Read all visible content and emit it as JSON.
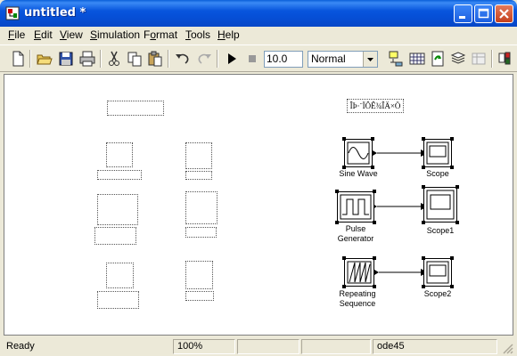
{
  "window": {
    "title": "untitled *"
  },
  "menu": [
    {
      "label": "File",
      "key": "F"
    },
    {
      "label": "Edit",
      "key": "E"
    },
    {
      "label": "View",
      "key": "V"
    },
    {
      "label": "Simulation",
      "key": "S"
    },
    {
      "label": "Format",
      "key": "o"
    },
    {
      "label": "Tools",
      "key": "T"
    },
    {
      "label": "Help",
      "key": "H"
    }
  ],
  "toolbar": {
    "stop_time": "10.0",
    "sim_mode": "Normal"
  },
  "canvas": {
    "garbled_text": "ÎÞ·¨ÏÔÊ¾ÎÄ×Ö",
    "blocks": {
      "sine_wave": "Sine Wave",
      "pulse_generator": "Pulse\nGenerator",
      "repeating_sequence": "Repeating\nSequence",
      "scope": "Scope",
      "scope1": "Scope1",
      "scope2": "Scope2"
    }
  },
  "status": {
    "state": "Ready",
    "zoom": "100%",
    "field3": "",
    "field4": "",
    "solver": "ode45"
  },
  "colors": {
    "titlebar": "#0855dd",
    "chrome": "#ece9d8"
  }
}
